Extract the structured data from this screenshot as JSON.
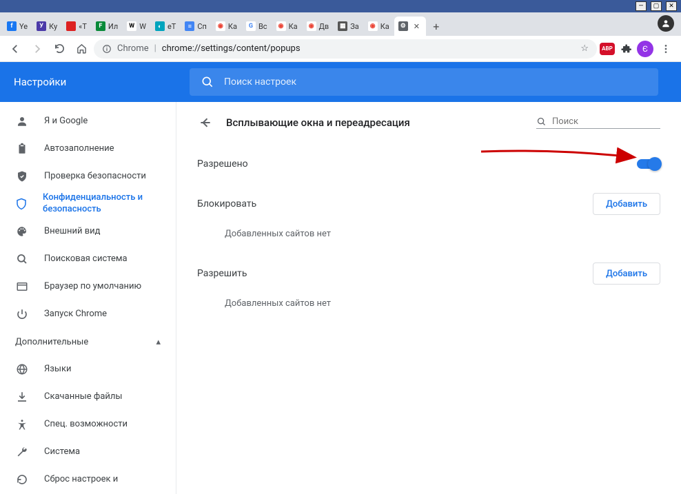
{
  "window": {
    "min": "—",
    "max": "▢",
    "close": "✕"
  },
  "tabs": [
    {
      "label": "Ye",
      "favBg": "#1877f2",
      "favTxt": "f"
    },
    {
      "label": "Ку",
      "favBg": "#4b3aa8",
      "favTxt": "У"
    },
    {
      "label": "«Т",
      "favBg": "#d22",
      "favTxt": ""
    },
    {
      "label": "Ил",
      "favBg": "#0a8a3a",
      "favTxt": "F"
    },
    {
      "label": "W",
      "favBg": "#fff",
      "favTxt": "W",
      "favColor": "#000"
    },
    {
      "label": "eT",
      "favBg": "#00a4bd",
      "favTxt": "◐"
    },
    {
      "label": "Сп",
      "favBg": "#4285f4",
      "favTxt": "≡"
    },
    {
      "label": "Ка",
      "favBg": "#fff",
      "favTxt": "◉",
      "favColor": "#ea4335"
    },
    {
      "label": "Вс",
      "favBg": "#fff",
      "favTxt": "G",
      "favColor": "#4285f4"
    },
    {
      "label": "Ка",
      "favBg": "#fff",
      "favTxt": "◉",
      "favColor": "#ea4335"
    },
    {
      "label": "Дв",
      "favBg": "#fff",
      "favTxt": "◉",
      "favColor": "#ea4335"
    },
    {
      "label": "За",
      "favBg": "#555",
      "favTxt": "▦"
    },
    {
      "label": "Ка",
      "favBg": "#fff",
      "favTxt": "◉",
      "favColor": "#ea4335"
    },
    {
      "label": "",
      "favBg": "#5f6368",
      "favTxt": "⚙",
      "active": true
    }
  ],
  "omnibox": {
    "brand": "Chrome",
    "url": "chrome://settings/content/popups"
  },
  "header": {
    "title": "Настройки",
    "search_placeholder": "Поиск настроек"
  },
  "sidebar": {
    "items": [
      {
        "icon": "person",
        "label": "Я и Google"
      },
      {
        "icon": "clipboard",
        "label": "Автозаполнение"
      },
      {
        "icon": "shield-check",
        "label": "Проверка безопасности"
      },
      {
        "icon": "shield",
        "label": "Конфиденциальность и безопасность",
        "active": true
      },
      {
        "icon": "palette",
        "label": "Внешний вид"
      },
      {
        "icon": "search",
        "label": "Поисковая система"
      },
      {
        "icon": "window",
        "label": "Браузер по умолчанию"
      },
      {
        "icon": "power",
        "label": "Запуск Chrome"
      }
    ],
    "advanced_label": "Дополнительные",
    "advanced_items": [
      {
        "icon": "globe",
        "label": "Языки"
      },
      {
        "icon": "download",
        "label": "Скачанные файлы"
      },
      {
        "icon": "accessibility",
        "label": "Спец. возможности"
      },
      {
        "icon": "wrench",
        "label": "Система"
      },
      {
        "icon": "reset",
        "label": "Сброс настроек и"
      }
    ]
  },
  "main": {
    "page_title": "Всплывающие окна и переадресация",
    "search_placeholder": "Поиск",
    "allowed_label": "Разрешено",
    "block_section": "Блокировать",
    "allow_section": "Разрешить",
    "add_button": "Добавить",
    "empty_msg": "Добавленных сайтов нет"
  }
}
